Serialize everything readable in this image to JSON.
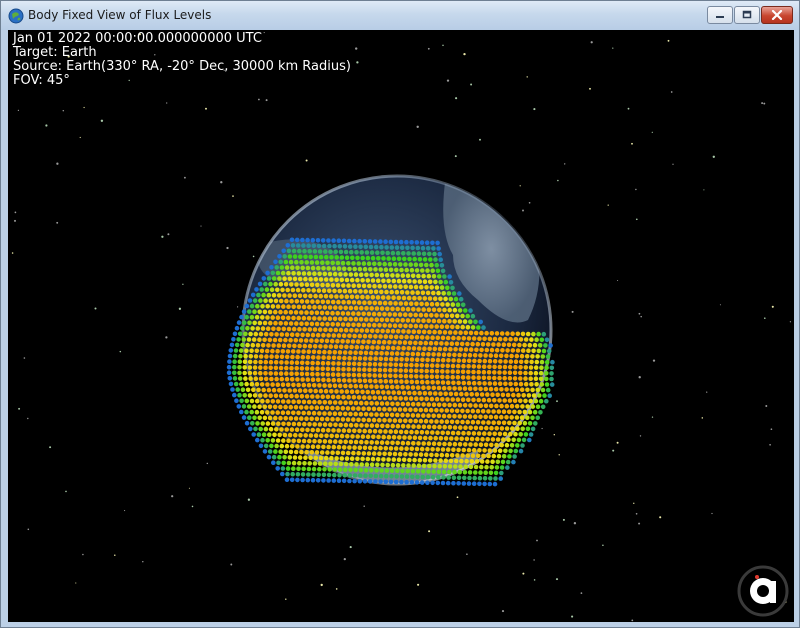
{
  "window": {
    "title": "Body Fixed View of Flux Levels",
    "icon": "globe-icon"
  },
  "controls": {
    "minimize_icon": "minimize-icon",
    "maximize_icon": "maximize-icon",
    "close_icon": "close-icon"
  },
  "hud": {
    "time": "Jan 01 2022 00:00:00.000000000 UTC",
    "target": "Target: Earth",
    "source": "Source: Earth(330° RA, -20° Dec, 30000 km Radius)",
    "fov": "FOV: 45°"
  },
  "logo": {
    "icon": "app-logo-icon"
  },
  "colors": {
    "background": "#000000",
    "flux_low": "#1f6fd0",
    "flux_mid": "#3cd11e",
    "flux_high": "#f2a900",
    "ocean": "#23344f",
    "land": "#6d7f92"
  }
}
